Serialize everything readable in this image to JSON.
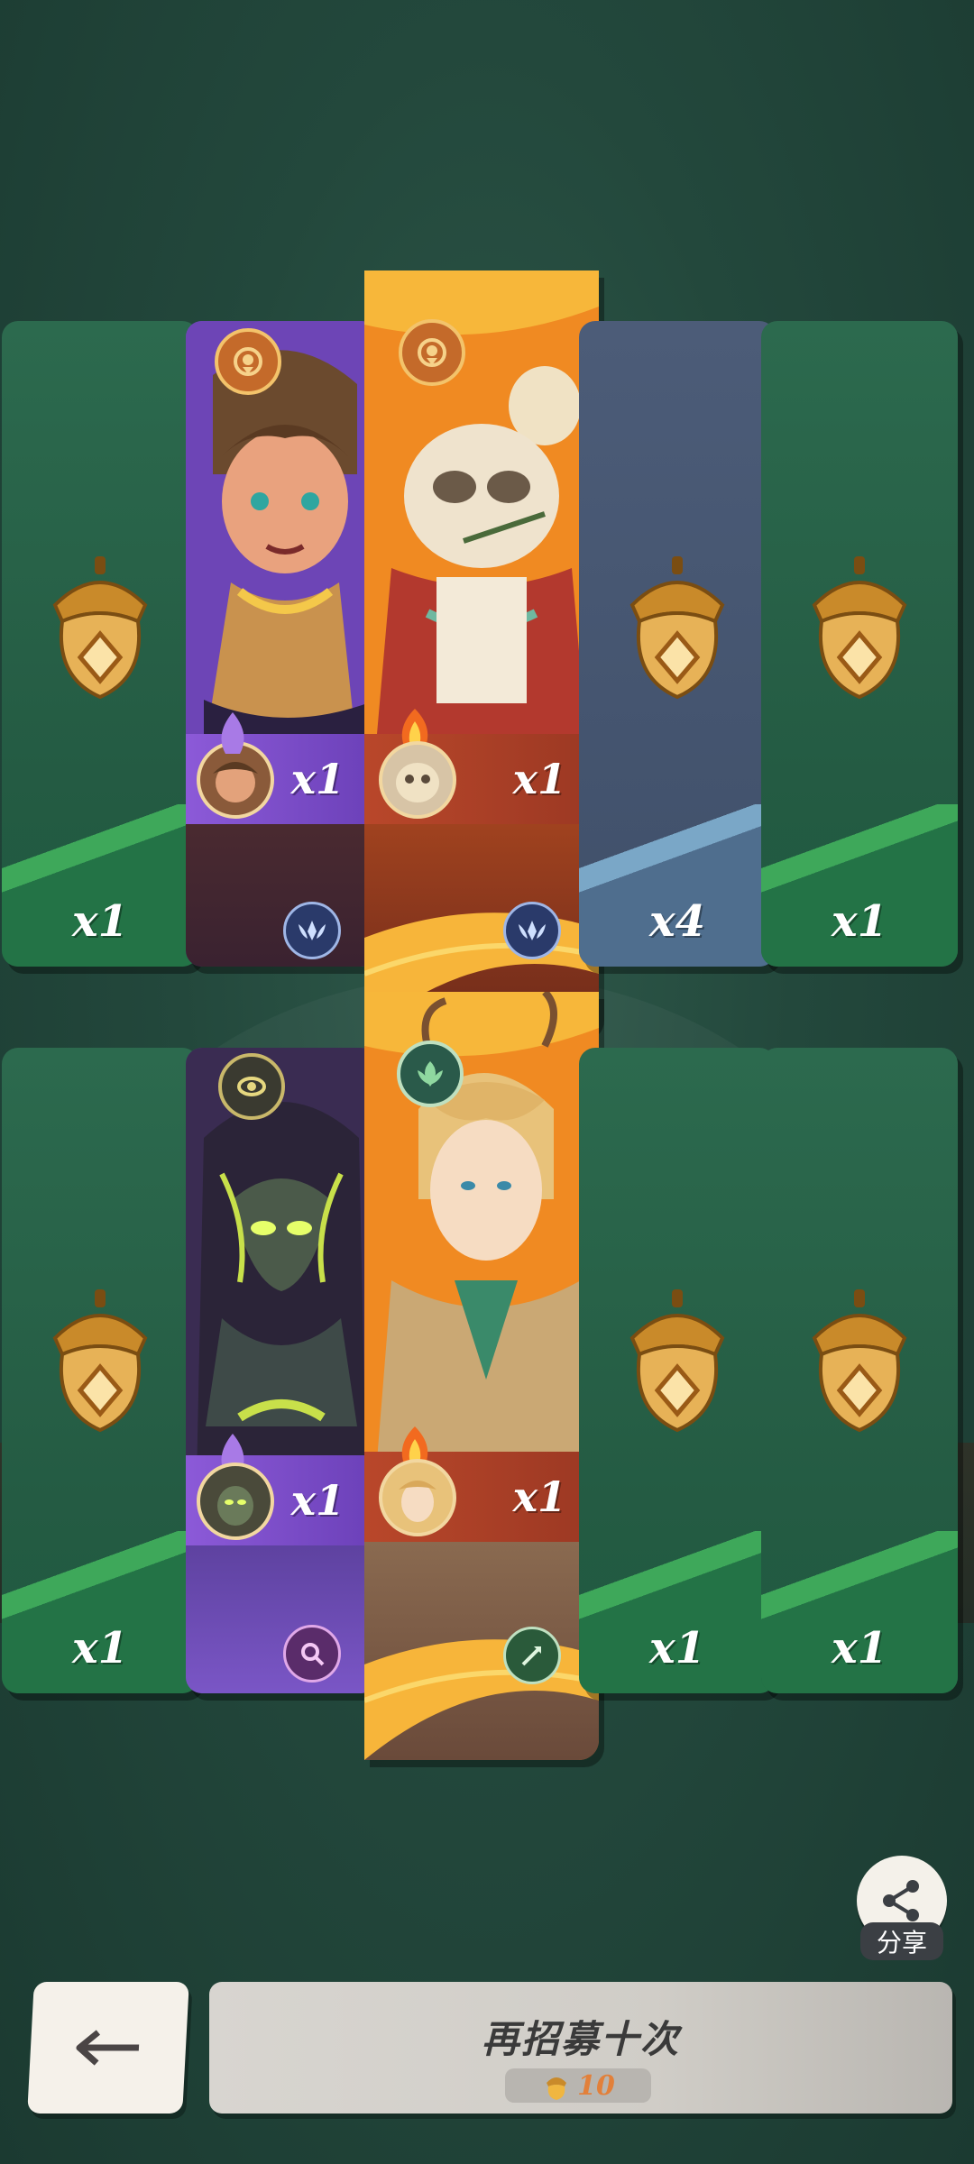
{
  "rows": [
    {
      "cards": [
        {
          "kind": "acorn",
          "color": "green",
          "count": "x1"
        },
        {
          "kind": "hero",
          "rarity": "purple",
          "count": "x1",
          "faction_icon": "sun-emblem-icon",
          "class_icon": "wings-icon"
        },
        {
          "kind": "hero",
          "rarity": "orange",
          "count": "x1",
          "faction_icon": "sun-emblem-icon",
          "class_icon": "wings-icon"
        },
        {
          "kind": "acorn",
          "color": "blue",
          "count": "x4"
        },
        {
          "kind": "acorn",
          "color": "green",
          "count": "x1"
        }
      ]
    },
    {
      "cards": [
        {
          "kind": "acorn",
          "color": "green",
          "count": "x1"
        },
        {
          "kind": "hero",
          "rarity": "purple",
          "count": "x1",
          "faction_icon": "eye-emblem-icon",
          "class_icon": "magic-icon"
        },
        {
          "kind": "hero",
          "rarity": "orange",
          "count": "x1",
          "faction_icon": "leaf-emblem-icon",
          "class_icon": "arrow-icon"
        },
        {
          "kind": "acorn",
          "color": "green",
          "count": "x1"
        },
        {
          "kind": "acorn",
          "color": "green",
          "count": "x1"
        }
      ]
    }
  ],
  "share": {
    "label": "分享"
  },
  "back": {
    "icon": "arrow-left-icon"
  },
  "recruit": {
    "label": "再招募十次",
    "cost": "10",
    "cost_icon": "golden-acorn-icon"
  },
  "colors": {
    "green_card": "#2c6a4e",
    "blue_card": "#4c5c78",
    "purple_hero": "#7b4fc0",
    "orange_hero": "#f29a2f",
    "background": "#23483c"
  }
}
